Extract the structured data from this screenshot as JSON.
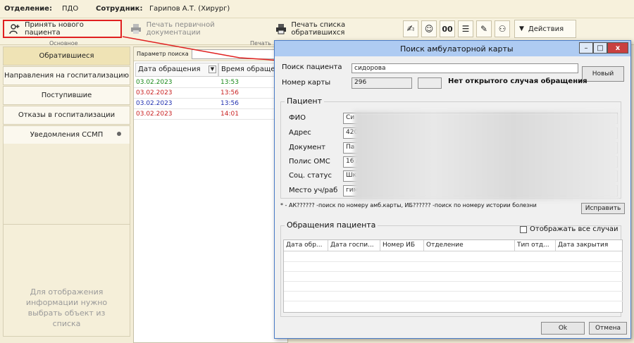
{
  "header": {
    "dept_label": "Отделение:",
    "dept_value": "ПДО",
    "staff_label": "Сотрудник:",
    "staff_value": "Гарипов А.Т. (Хирург)"
  },
  "toolbar": {
    "new_patient": "Принять нового пациента",
    "print_docs": "Печать первичной документации",
    "print_list": "Печать списка обратившихся",
    "actions": "Действия",
    "group_main": "Основное",
    "group_print": "Печать"
  },
  "leftnav": {
    "items": [
      {
        "label": "Обратившиеся"
      },
      {
        "label": "Направления на госпитализацию"
      },
      {
        "label": "Поступившие"
      },
      {
        "label": "Отказы в госпитализации"
      },
      {
        "label": "Уведомления ССМП"
      }
    ],
    "info_text": "Для отображения информации нужно выбрать объект из списка"
  },
  "center": {
    "param_label": "Параметр поиска",
    "col_date": "Дата обращения",
    "col_time": "Время обраще",
    "rows": [
      {
        "date": "03.02.2023",
        "time": "13:53",
        "color": "#1a8a1a"
      },
      {
        "date": "03.02.2023",
        "time": "13:56",
        "color": "#c81e1e"
      },
      {
        "date": "03.02.2023",
        "time": "13:56",
        "color": "#2030b0"
      },
      {
        "date": "03.02.2023",
        "time": "14:01",
        "color": "#c81e1e"
      }
    ]
  },
  "dialog": {
    "title": "Поиск амбулаторной карты",
    "search_label": "Поиск пациента",
    "search_value": "сидорова",
    "card_label": "Номер карты",
    "card_value": "296",
    "no_case": "Нет открытого случая обращения",
    "new_button": "Новый",
    "patient_group": "Пациент",
    "fio_label": "ФИО",
    "fio_value": "Си",
    "address_label": "Адрес",
    "address_value": "420",
    "doc_label": "Документ",
    "doc_value": "Па",
    "oms_label": "Полис ОМС",
    "oms_value": "16 /",
    "status_label": "Соц. статус",
    "status_value": "Шк",
    "work_label": "Место уч/раб",
    "work_value": "гимназия ч.",
    "hint": "* - АК?????? -поиск по номеру амб.карты, ИБ?????? -поиск по номеру истории болезни",
    "fix_button": "Исправить",
    "visits_group": "Обращения пациента",
    "show_all": "Отображать все случаи",
    "cols": [
      "Дата обр...",
      "Дата госпи...",
      "Номер ИБ",
      "Отделение",
      "Тип отд...",
      "Дата закрытия"
    ],
    "ok_button": "Ok",
    "cancel_button": "Отмена"
  },
  "colors": {
    "accent_red": "#e02020",
    "title_bar": "#aecbf2",
    "background": "#f3edd7"
  }
}
